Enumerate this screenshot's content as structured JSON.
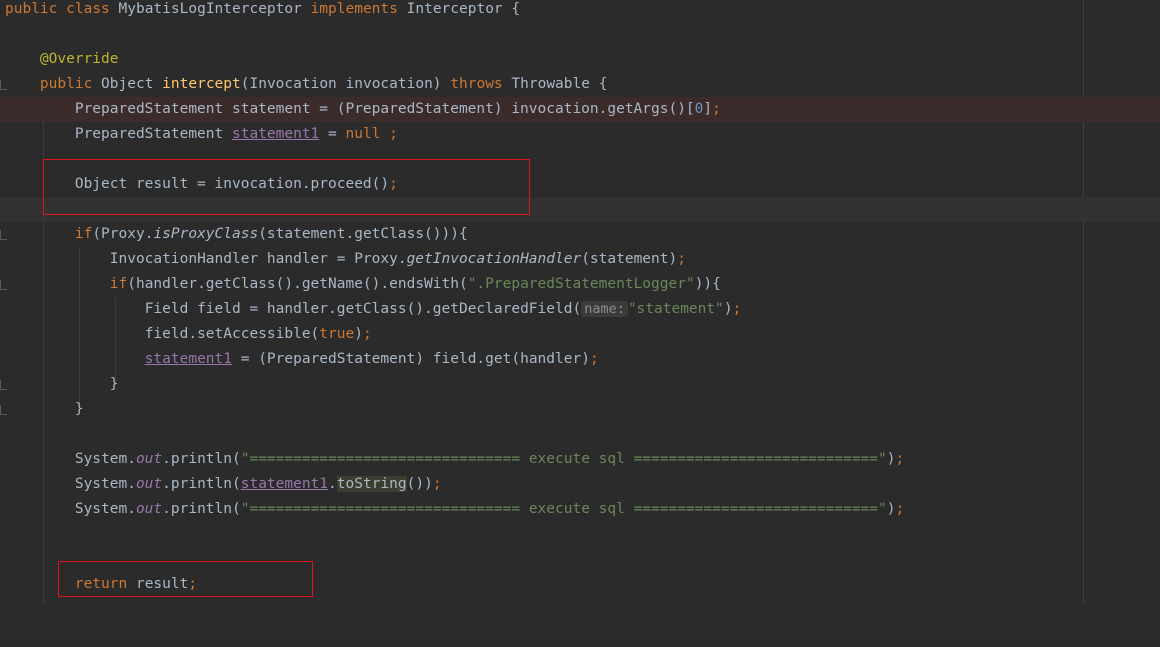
{
  "editor": {
    "lines": {
      "l1": {
        "kw1": "public",
        "kw2": "class",
        "name": "MybatisLogInterceptor",
        "kw3": "implements",
        "iface": "Interceptor",
        "brace": "{"
      },
      "l3": {
        "annotation": "@Override"
      },
      "l4": {
        "kw1": "public",
        "t1": "Object",
        "method": "intercept",
        "t2": "(Invocation invocation)",
        "kw2": "throws",
        "t3": "Throwable {"
      },
      "l5": {
        "t1": "PreparedStatement statement = (PreparedStatement) invocation.getArgs()[",
        "num": "0",
        "t2": "]",
        "semi": ";"
      },
      "l6": {
        "t1": "PreparedStatement",
        "var": "statement1",
        "t2": "=",
        "kw": "null",
        "semi": ";"
      },
      "l8": {
        "t1": "Object result = invocation.proceed()",
        "semi": ";"
      },
      "l10": {
        "kw": "if",
        "t1": "(Proxy.",
        "static": "isProxyClass",
        "t2": "(statement.getClass())){"
      },
      "l11": {
        "t1": "InvocationHandler handler = Proxy.",
        "static": "getInvocationHandler",
        "t2": "(statement)",
        "semi": ";"
      },
      "l12": {
        "kw": "if",
        "t1": "(handler.getClass().getName().endsWith(",
        "str": "\".PreparedStatementLogger\"",
        "t2": ")){"
      },
      "l13": {
        "t1": "Field field = handler.getClass().getDeclaredField(",
        "hint": "name:",
        "str": "\"statement\"",
        "t2": ")",
        "semi": ";"
      },
      "l14": {
        "t1": "field.setAccessible(",
        "kw": "true",
        "t2": ")",
        "semi": ";"
      },
      "l15": {
        "var": "statement1",
        "t1": "= (PreparedStatement) field.get(handler)",
        "semi": ";"
      },
      "l16": {
        "t1": "}"
      },
      "l17": {
        "t1": "}"
      },
      "l19": {
        "t1": "System.",
        "stat": "out",
        "t2": ".println(",
        "str": "\"=============================== execute sql ============================\"",
        "t3": ")",
        "semi": ";"
      },
      "l20": {
        "t1": "System.",
        "stat": "out",
        "t2": ".println(",
        "var": "statement1",
        "dot": ".",
        "sel": "toString",
        "t3": "())",
        "semi": ";"
      },
      "l21": {
        "t1": "System.",
        "stat": "out",
        "t2": ".println(",
        "str": "\"=============================== execute sql ============================\"",
        "t3": ")",
        "semi": ";"
      },
      "l24": {
        "kw": "return",
        "t1": "result",
        "semi": ";"
      }
    },
    "colors": {
      "keyword": "#cc7832",
      "string": "#6a8759",
      "function": "#ffc66d",
      "annotation": "#bbb529",
      "number": "#6897bb",
      "field": "#9876aa",
      "highlight_box": "#e0141e"
    }
  }
}
